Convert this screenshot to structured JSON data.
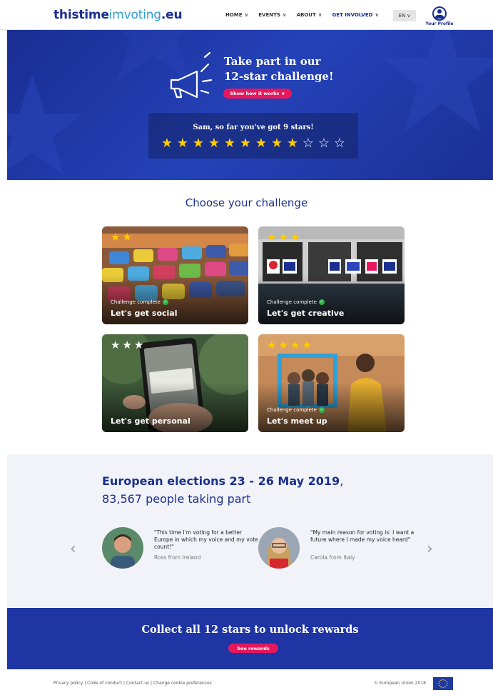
{
  "header": {
    "logo": {
      "part1": "thistime",
      "part2": "imvoting",
      "part3": ".eu"
    },
    "nav": [
      {
        "label": "HOME"
      },
      {
        "label": "EVENTS"
      },
      {
        "label": "ABOUT"
      },
      {
        "label": "GET INVOLVED"
      }
    ],
    "language": "EN",
    "profile_label": "Your Profile"
  },
  "hero": {
    "title_line1": "Take part in our",
    "title_line2": "12-star challenge!",
    "how_button": "Show how it works",
    "stars_text": "Sam, so far you've got 9 stars!",
    "stars_earned": 9,
    "stars_total": 12
  },
  "challenges": {
    "title": "Choose your challenge",
    "cards": [
      {
        "title": "Let's get social",
        "status": "Challenge complete",
        "stars_earned": 2,
        "stars_total": 2
      },
      {
        "title": "Let's get creative",
        "status": "Challenge complete",
        "stars_earned": 3,
        "stars_total": 3
      },
      {
        "title": "Let's get personal",
        "status": "",
        "stars_earned": 0,
        "stars_total": 3
      },
      {
        "title": "Let's meet up",
        "status": "Challenge complete",
        "stars_earned": 4,
        "stars_total": 4
      }
    ]
  },
  "elections": {
    "heading_bold": "European elections 23 - 26 May 2019",
    "heading_rest": ",",
    "subheading": "83,567 people taking part",
    "testimonials": [
      {
        "quote": "\"This time I'm voting for a better Europe in which my voice and my vote count!\"",
        "author": "Ross from Ireland"
      },
      {
        "quote": "\"My main reason for voting is: I want a future where I made my voice heard\"",
        "author": "Carola from Italy"
      }
    ],
    "prev_icon": "chevron-left-icon",
    "next_icon": "chevron-right-icon"
  },
  "rewards": {
    "title": "Collect all 12 stars to unlock rewards",
    "button": "See rewards"
  },
  "footer": {
    "links": "Privacy policy | Code of conduct | Contact us | Change cookie preferences",
    "copyright": "© European Union 2018"
  },
  "colors": {
    "brand": "#1a2f8f",
    "accent": "#e8175d",
    "star": "#ffcc00"
  }
}
